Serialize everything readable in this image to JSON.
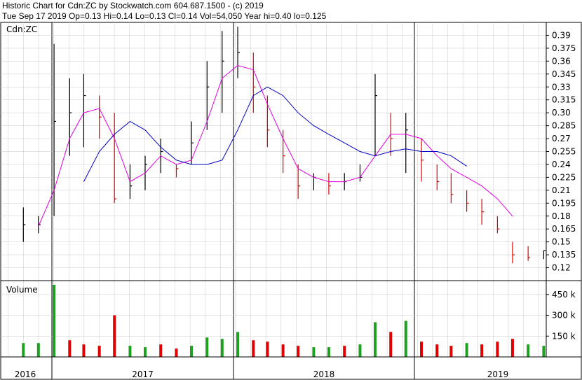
{
  "header": {
    "line1": "Historic Chart for Cdn:ZC by Stockwatch.com 604.687.1500 - (c) 2019",
    "line2": "Tue Sep 17 2019  Op=0.13  Hi=0.14  Lo=0.13  Cl=0.14  Vol=54,050  Year hi=0.40  lo=0.125"
  },
  "colors": {
    "up": "#000000",
    "down": "#e00000",
    "ma_short": "#e000e0",
    "ma_long": "#0000c0",
    "vol_up": "#20a020",
    "vol_down": "#e00000",
    "grid": "#c8c8c8"
  },
  "chart_data": [
    {
      "type": "line",
      "title": "Cdn:ZC",
      "x_labels": [
        "2016",
        "2017",
        "2018",
        "2019"
      ],
      "ylim": [
        0.105,
        0.405
      ],
      "y_ticks": [
        "0.39",
        "0.375",
        "0.36",
        "0.345",
        "0.33",
        "0.315",
        "0.30",
        "0.285",
        "0.27",
        "0.255",
        "0.24",
        "0.225",
        "0.21",
        "0.195",
        "0.18",
        "0.165",
        "0.15",
        "0.135",
        "0.12"
      ],
      "x": [
        "2016-11",
        "2016-12",
        "2017-01",
        "2017-02",
        "2017-03",
        "2017-04",
        "2017-05",
        "2017-06",
        "2017-07",
        "2017-08",
        "2017-09",
        "2017-10",
        "2017-11",
        "2017-12",
        "2018-01",
        "2018-02",
        "2018-03",
        "2018-04",
        "2018-05",
        "2018-06",
        "2018-07",
        "2018-08",
        "2018-09",
        "2018-10",
        "2018-11",
        "2018-12",
        "2019-01",
        "2019-02",
        "2019-03",
        "2019-04",
        "2019-05",
        "2019-06",
        "2019-07",
        "2019-08",
        "2019-09"
      ],
      "series": [
        {
          "style": "bar",
          "high": [
            0.19,
            0.18,
            0.38,
            0.34,
            0.345,
            0.32,
            0.3,
            0.24,
            0.25,
            0.27,
            0.24,
            0.29,
            0.36,
            0.395,
            0.4,
            0.37,
            0.32,
            0.28,
            0.24,
            0.23,
            0.23,
            0.23,
            0.24,
            0.345,
            0.3,
            0.3,
            0.27,
            0.24,
            0.23,
            0.21,
            0.2,
            0.18,
            0.15,
            0.145,
            0.14
          ],
          "low": [
            0.15,
            0.16,
            0.18,
            0.25,
            0.26,
            0.27,
            0.195,
            0.2,
            0.21,
            0.23,
            0.225,
            0.24,
            0.28,
            0.3,
            0.34,
            0.3,
            0.26,
            0.23,
            0.2,
            0.21,
            0.205,
            0.21,
            0.22,
            0.25,
            0.25,
            0.23,
            0.22,
            0.21,
            0.195,
            0.185,
            0.17,
            0.16,
            0.125,
            0.128,
            0.13
          ],
          "close": [
            0.17,
            0.17,
            0.29,
            0.3,
            0.32,
            0.295,
            0.2,
            0.215,
            0.24,
            0.255,
            0.235,
            0.265,
            0.33,
            0.36,
            0.37,
            0.33,
            0.28,
            0.25,
            0.215,
            0.225,
            0.215,
            0.22,
            0.225,
            0.32,
            0.27,
            0.28,
            0.245,
            0.22,
            0.205,
            0.195,
            0.185,
            0.165,
            0.135,
            0.132,
            0.14
          ]
        },
        {
          "style": "line",
          "values": [
            null,
            0.168,
            0.21,
            0.27,
            0.3,
            0.305,
            0.27,
            0.22,
            0.23,
            0.25,
            0.24,
            0.245,
            0.29,
            0.34,
            0.355,
            0.35,
            0.31,
            0.27,
            0.235,
            0.225,
            0.22,
            0.22,
            0.225,
            0.25,
            0.275,
            0.275,
            0.27,
            0.25,
            0.235,
            0.225,
            0.215,
            0.2,
            0.18,
            null,
            null
          ]
        },
        {
          "style": "line",
          "values": [
            null,
            null,
            null,
            null,
            0.22,
            0.255,
            0.275,
            0.29,
            0.28,
            0.26,
            0.245,
            0.24,
            0.24,
            0.245,
            0.28,
            0.32,
            0.33,
            0.32,
            0.3,
            0.285,
            0.275,
            0.265,
            0.255,
            0.25,
            0.255,
            0.258,
            0.255,
            0.255,
            0.25,
            0.238,
            null,
            null,
            null,
            null,
            null
          ]
        }
      ]
    },
    {
      "type": "bar",
      "title": "Volume",
      "y_ticks": [
        "450 k",
        "300 k",
        "150 k"
      ],
      "ylim": [
        0,
        550
      ],
      "x": [
        "2016-11",
        "2016-12",
        "2017-01",
        "2017-02",
        "2017-03",
        "2017-04",
        "2017-05",
        "2017-06",
        "2017-07",
        "2017-08",
        "2017-09",
        "2017-10",
        "2017-11",
        "2017-12",
        "2018-01",
        "2018-02",
        "2018-03",
        "2018-04",
        "2018-05",
        "2018-06",
        "2018-07",
        "2018-08",
        "2018-09",
        "2018-10",
        "2018-11",
        "2018-12",
        "2019-01",
        "2019-02",
        "2019-03",
        "2019-04",
        "2019-05",
        "2019-06",
        "2019-07",
        "2019-08",
        "2019-09"
      ],
      "values": [
        100,
        100,
        520,
        120,
        90,
        80,
        300,
        80,
        70,
        90,
        60,
        80,
        140,
        130,
        180,
        120,
        110,
        90,
        80,
        70,
        70,
        80,
        90,
        250,
        180,
        260,
        110,
        90,
        80,
        100,
        90,
        110,
        130,
        90,
        80
      ],
      "direction": [
        "up",
        "up",
        "up",
        "down",
        "down",
        "down",
        "down",
        "up",
        "up",
        "down",
        "down",
        "up",
        "up",
        "up",
        "up",
        "down",
        "down",
        "down",
        "down",
        "up",
        "up",
        "down",
        "up",
        "up",
        "down",
        "up",
        "down",
        "down",
        "down",
        "up",
        "down",
        "down",
        "down",
        "up",
        "up"
      ]
    }
  ]
}
